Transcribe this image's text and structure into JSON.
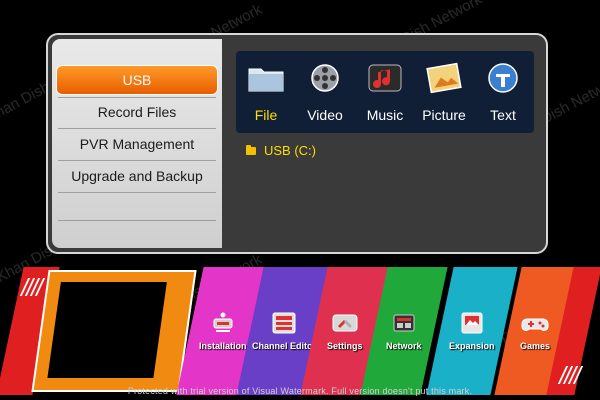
{
  "menu": {
    "items": [
      {
        "label": "USB",
        "active": true
      },
      {
        "label": "Record Files",
        "active": false
      },
      {
        "label": "PVR Management",
        "active": false
      },
      {
        "label": "Upgrade and Backup",
        "active": false
      }
    ]
  },
  "media_types": [
    {
      "label": "File",
      "icon": "folder-icon",
      "active": true
    },
    {
      "label": "Video",
      "icon": "film-reel-icon",
      "active": false
    },
    {
      "label": "Music",
      "icon": "music-note-icon",
      "active": false
    },
    {
      "label": "Picture",
      "icon": "picture-icon",
      "active": false
    },
    {
      "label": "Text",
      "icon": "text-document-icon",
      "active": false
    }
  ],
  "devices": [
    {
      "label": "USB (C:)",
      "icon": "folder-icon"
    }
  ],
  "ribbon": {
    "tiles": [
      {
        "label": "Installation",
        "icon": "installation-icon",
        "color": "#e335c8"
      },
      {
        "label": "Channel Editor",
        "icon": "channel-editor-icon",
        "color": "#6a3fc8"
      },
      {
        "label": "Settings",
        "icon": "settings-icon",
        "color": "#e0304f"
      },
      {
        "label": "Network",
        "icon": "network-icon",
        "color": "#20a83a"
      },
      {
        "label": "Expansion",
        "icon": "expansion-icon",
        "color": "#1ab0c8"
      },
      {
        "label": "Games",
        "icon": "games-icon",
        "color": "#ee5a22"
      }
    ]
  },
  "watermarks": {
    "text": "Khan Dish Network",
    "trial_notice": "Protected with trial version of Visual Watermark. Full version doesn't put this mark."
  },
  "colors": {
    "accent_orange": "#f07b12",
    "active_text": "#ffdd00",
    "panel_bg": "#3a3a3a",
    "type_bar_bg": "#101e36"
  }
}
